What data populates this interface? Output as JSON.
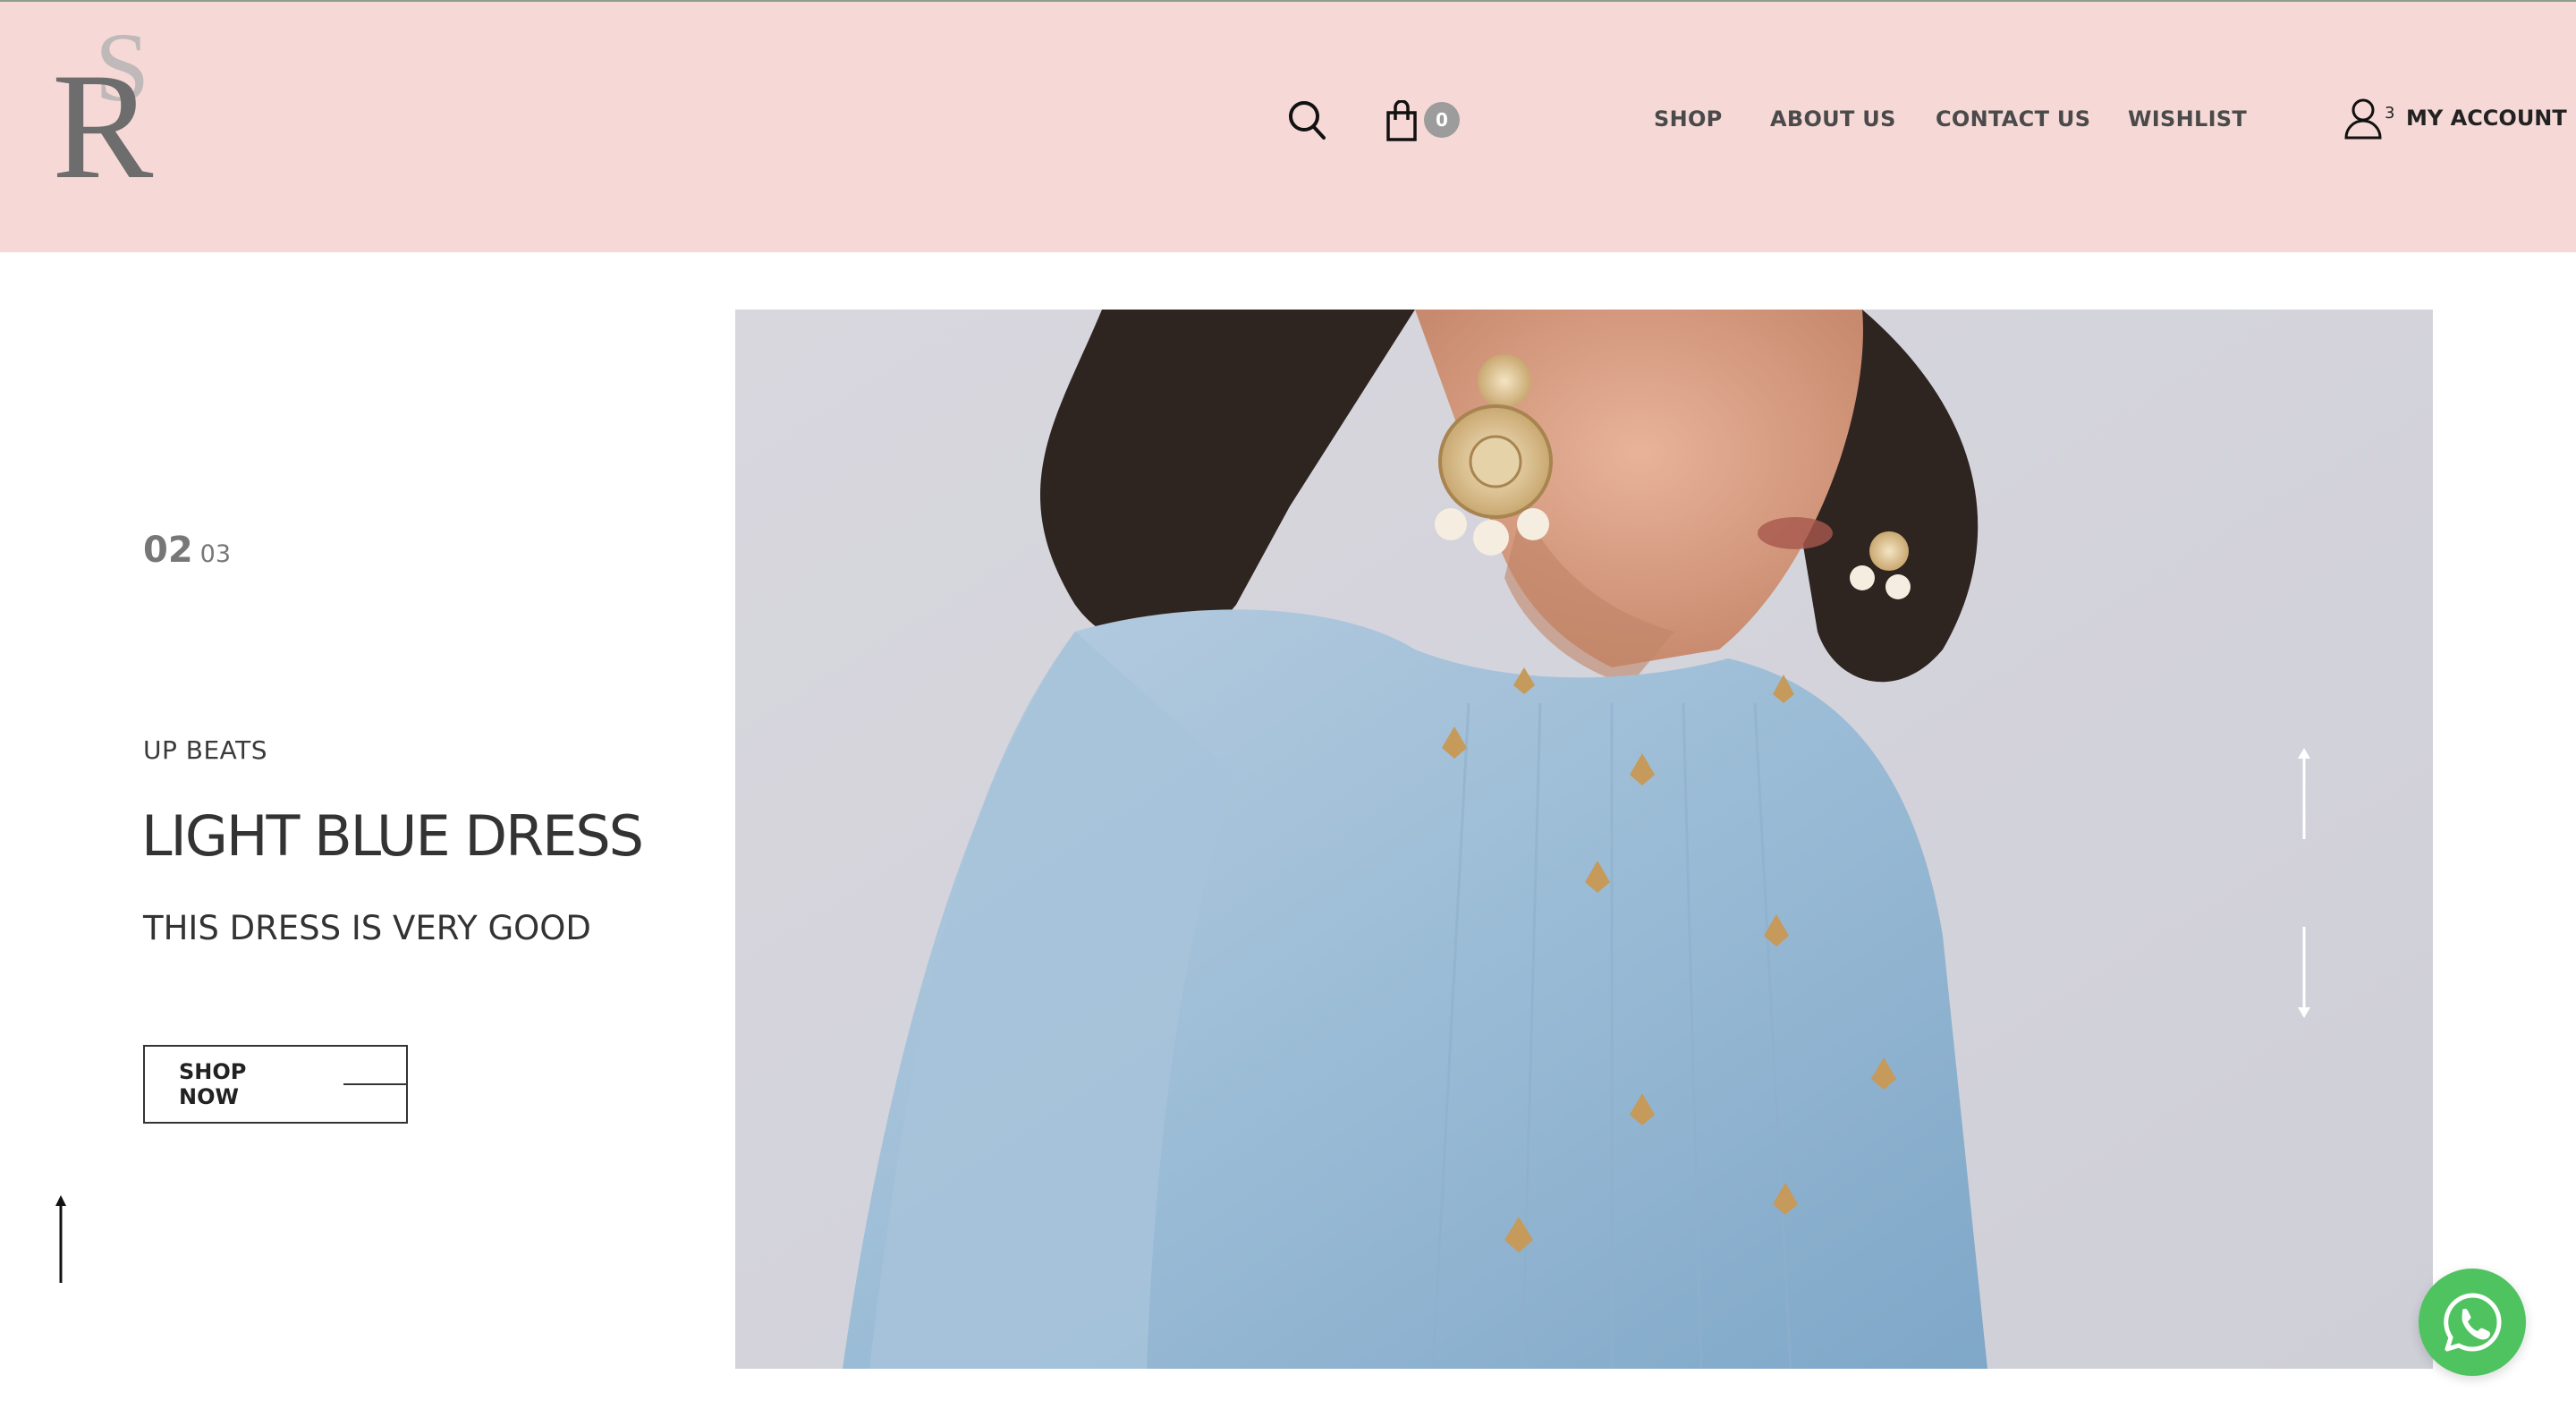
{
  "header": {
    "logo_letters": "RS",
    "cart_count": "0",
    "nav": {
      "shop": "SHOP",
      "about": "ABOUT US",
      "contact": "CONTACT US",
      "wishlist": "WISHLIST"
    },
    "account_count": "3",
    "account_label": "MY ACCOUNT",
    "icons": {
      "search": "search-icon",
      "cart": "shopping-bag-icon",
      "account": "user-icon"
    }
  },
  "hero": {
    "slide_current": "02",
    "slide_total": "03",
    "eyebrow": "UP BEATS",
    "title": "LIGHT BLUE DRESS",
    "subtitle": "THIS DRESS IS VERY GOOD",
    "cta_label": "SHOP NOW",
    "icons": {
      "prev": "arrow-up-icon",
      "next": "arrow-down-icon",
      "scroll_top": "arrow-up-icon",
      "chat": "whatsapp-icon"
    }
  },
  "colors": {
    "header_bg": "#f6d9d6",
    "dress_blue": "#9bbcd6",
    "whatsapp_green": "#4fc35f"
  }
}
